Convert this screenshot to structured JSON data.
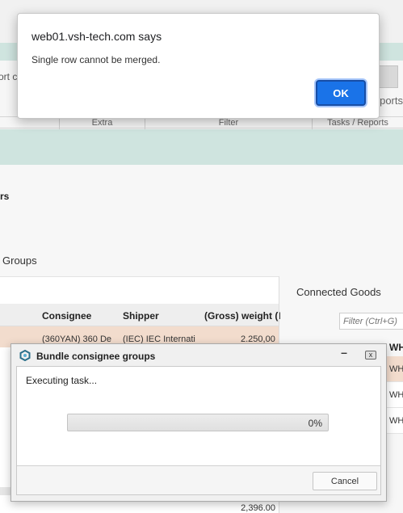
{
  "alert": {
    "title": "web01.vsh-tech.com says",
    "message": "Single row cannot be merged.",
    "ok_label": "OK"
  },
  "ribbon": {
    "cut_left_text": "ort c",
    "reports_cut_text": "ports",
    "groups": [
      "Extra",
      "Filter",
      "Tasks / Reports"
    ]
  },
  "page": {
    "section_cut_label": "rs",
    "groups_title": "Groups"
  },
  "table": {
    "headers": [
      "Consignee",
      "Shipper",
      "(Gross) weight (I"
    ],
    "selected_row": [
      "(360YAN) 360 De",
      "(IEC) IEC Internati",
      "2.250,00"
    ],
    "total": "2,396.00"
  },
  "right_panel": {
    "title": "Connected Goods",
    "filter_placeholder": "Filter (Ctrl+G)",
    "header": "WH",
    "rows": [
      "WH",
      "WH",
      "WH"
    ]
  },
  "dialog": {
    "title": "Bundle consignee groups",
    "status": "Executing task...",
    "progress_text": "0%",
    "progress_value": 0,
    "cancel_label": "Cancel",
    "close_label": "x",
    "minimize_label": "–"
  },
  "colors": {
    "accent": "#1a73e8",
    "teal_band": "#cfe4df",
    "selected_row": "#f2dccd"
  }
}
